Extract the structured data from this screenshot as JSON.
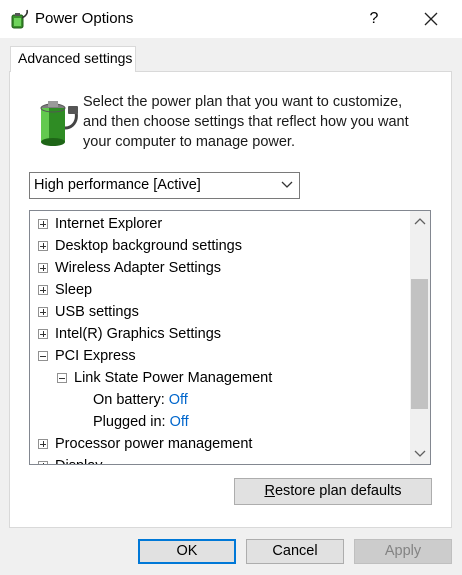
{
  "window": {
    "title": "Power Options",
    "help_label": "?",
    "icons": {
      "app": "power-options-icon",
      "help": "help-icon",
      "close": "close-icon"
    }
  },
  "tab": {
    "label": "Advanced settings"
  },
  "description": "Select the power plan that you want to customize, and then choose settings that reflect how you want your computer to manage power.",
  "plan_select": {
    "value": "High performance [Active]",
    "icon": "chevron-down-icon"
  },
  "tree": {
    "items": [
      {
        "label": "Internet Explorer",
        "expanded": false
      },
      {
        "label": "Desktop background settings",
        "expanded": false
      },
      {
        "label": "Wireless Adapter Settings",
        "expanded": false
      },
      {
        "label": "Sleep",
        "expanded": false
      },
      {
        "label": "USB settings",
        "expanded": false
      },
      {
        "label": "Intel(R) Graphics Settings",
        "expanded": false
      },
      {
        "label": "PCI Express",
        "expanded": true
      },
      {
        "label": "Link State Power Management",
        "expanded": true
      },
      {
        "label": "On battery:",
        "value": "Off"
      },
      {
        "label": "Plugged in:",
        "value": "Off"
      },
      {
        "label": "Processor power management",
        "expanded": false
      },
      {
        "label": "Display",
        "expanded": false
      }
    ]
  },
  "restore_button": {
    "underline_char": "R",
    "rest": "estore plan defaults"
  },
  "buttons": {
    "ok": "OK",
    "cancel": "Cancel",
    "apply": "Apply"
  },
  "colors": {
    "accent": "#0078d7",
    "value_link": "#0066cc"
  }
}
